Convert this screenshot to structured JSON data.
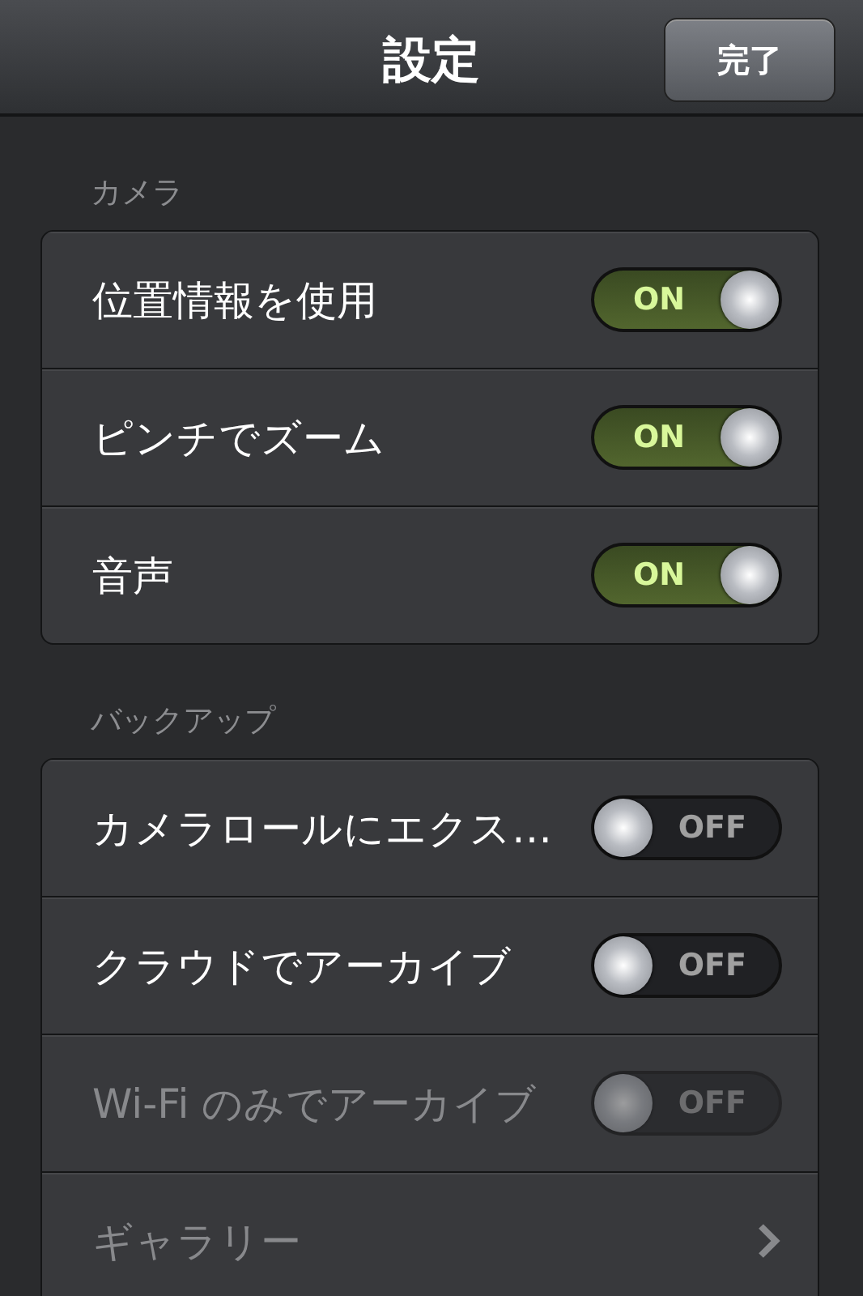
{
  "navigation_bar": {
    "title": "設定",
    "done_button": "完了"
  },
  "sections": [
    {
      "header": "カメラ",
      "rows": [
        {
          "kind": "switch",
          "label": "位置情報を使用",
          "on": true,
          "disabled": false,
          "switch_label": "ON"
        },
        {
          "kind": "switch",
          "label": "ピンチでズーム",
          "on": true,
          "disabled": false,
          "switch_label": "ON"
        },
        {
          "kind": "switch",
          "label": "音声",
          "on": true,
          "disabled": false,
          "switch_label": "ON"
        }
      ]
    },
    {
      "header": "バックアップ",
      "rows": [
        {
          "kind": "switch",
          "label": "カメラロールにエクス…",
          "on": false,
          "disabled": false,
          "switch_label": "OFF"
        },
        {
          "kind": "switch",
          "label": "クラウドでアーカイブ",
          "on": false,
          "disabled": false,
          "switch_label": "OFF"
        },
        {
          "kind": "switch",
          "label": "Wi-Fi のみでアーカイブ",
          "on": false,
          "disabled": true,
          "switch_label": "OFF"
        },
        {
          "kind": "link",
          "label": "ギャラリー",
          "disabled": true
        }
      ]
    }
  ]
}
